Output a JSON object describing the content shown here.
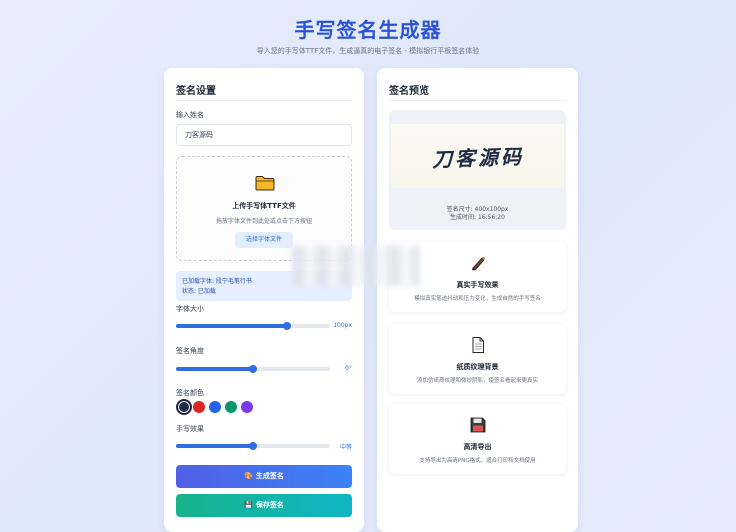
{
  "header": {
    "title": "手写签名生成器",
    "subtitle": "导入您的手写体TTF文件，生成逼真的电子签名 - 模拟银行平板签名体验"
  },
  "settings": {
    "heading": "签名设置",
    "name_label": "输入姓名",
    "name_value": "刀客源码",
    "upload": {
      "icon": "folder-icon",
      "title": "上传手写体TTF文件",
      "hint": "拖放字体文件到此处或点击下方按钮",
      "button_label": "选择字体文件"
    },
    "font_status": {
      "loaded_font": "已加载字体: 段宁毛笔行书",
      "state": "状态: 已加载"
    },
    "font_size": {
      "label": "字体大小",
      "value_text": "100px",
      "level": 0.72
    },
    "angle": {
      "label": "签名角度",
      "value_text": "0°",
      "level": 0.5
    },
    "color": {
      "label": "签名颜色",
      "options": [
        "#1f2a44",
        "#dc2626",
        "#2563eb",
        "#059669",
        "#7c3aed"
      ],
      "selected_index": 0
    },
    "effect": {
      "label": "手写效果",
      "value_text": "中等",
      "level": 0.5
    },
    "generate_label": "生成签名",
    "generate_icon": "palette-icon",
    "save_label": "保存签名",
    "save_icon": "floppy-icon"
  },
  "preview": {
    "heading": "签名预览",
    "signature_text": "刀客源码",
    "size_text": "签名尺寸: 400x100px",
    "time_text": "生成时间: 16:56:20"
  },
  "features": [
    {
      "icon": "pen-icon",
      "title": "真实手写效果",
      "desc": "模拟真实笔迹抖动和压力变化，生成自然的手写签名"
    },
    {
      "icon": "document-icon",
      "title": "纸质纹理背景",
      "desc": "添加仿纸质纹理和微妙阴影，使签名看起来更真实"
    },
    {
      "icon": "floppy-icon",
      "title": "高清导出",
      "desc": "支持导出为高清PNG格式，适合打印和文档使用"
    }
  ],
  "colors": {
    "title": "#2a52d6",
    "accent": "#2f6fe0",
    "generate_gradient_start": "#5160e6",
    "save_gradient_start": "#17b38a"
  }
}
